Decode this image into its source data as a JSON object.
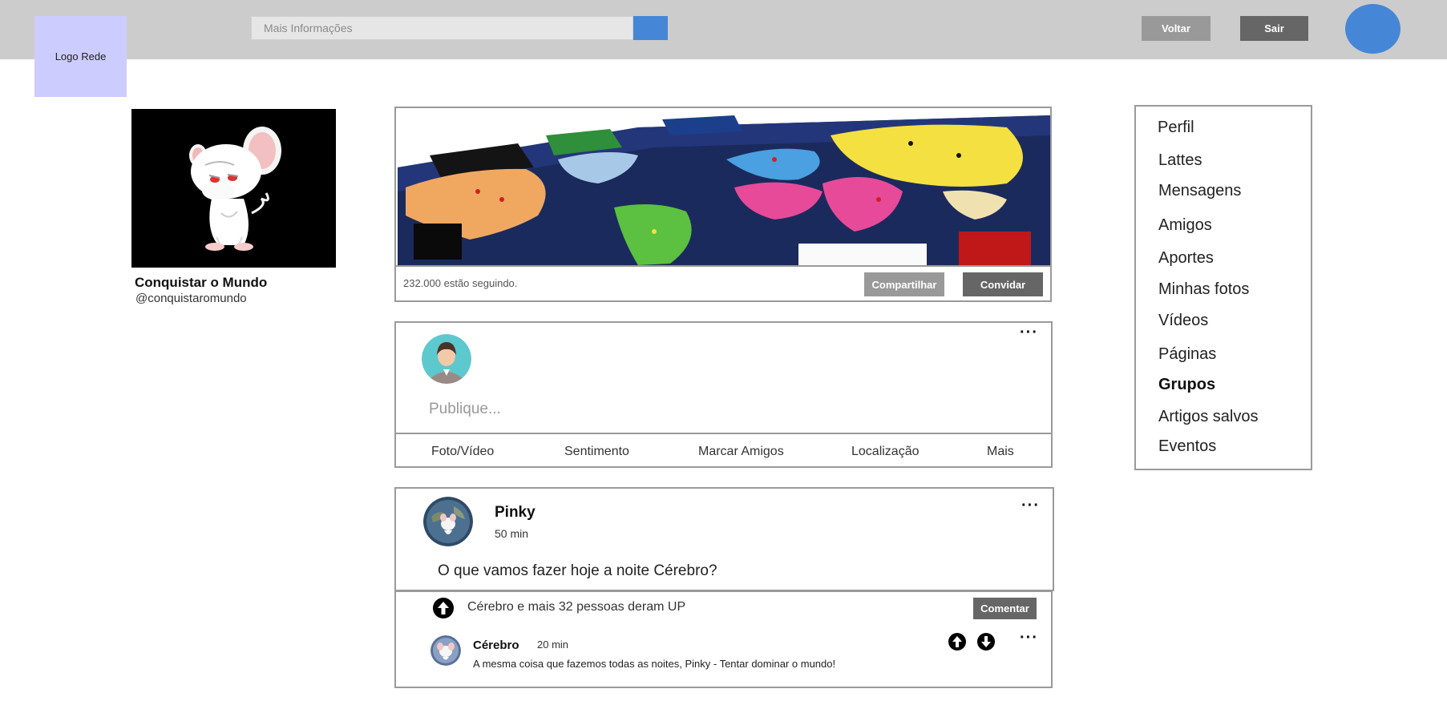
{
  "header": {
    "logo_text": "Logo Rede",
    "search_placeholder": "Mais Informações",
    "back_label": "Voltar",
    "exit_label": "Sair",
    "accent_color": "#4587d6"
  },
  "profile": {
    "name": "Conquistar o Mundo",
    "handle": "@conquistaromundo"
  },
  "cover": {
    "followers_text": "232.000 estão seguindo.",
    "share_label": "Compartilhar",
    "invite_label": "Convidar"
  },
  "composer": {
    "placeholder": "Publique...",
    "actions": [
      "Foto/Vídeo",
      "Sentimento",
      "Marcar Amigos",
      "Localização",
      "Mais"
    ]
  },
  "post": {
    "author": "Pinky",
    "time": "50 min",
    "text": "O que vamos fazer hoje a noite Cérebro?",
    "likes_text": "Cérebro e mais 32 pessoas deram UP",
    "comment_label": "Comentar"
  },
  "comment": {
    "author": "Cérebro",
    "time": "20 min",
    "text": "A mesma coisa que fazemos todas as noites, Pinky - Tentar dominar o mundo!"
  },
  "menu": {
    "items": [
      "Perfil",
      "Lattes",
      "Mensagens",
      "Amigos",
      "Aportes",
      "Minhas fotos",
      "Vídeos",
      "Páginas",
      "Grupos",
      "Artigos salvos",
      "Eventos"
    ],
    "active": "Grupos"
  }
}
